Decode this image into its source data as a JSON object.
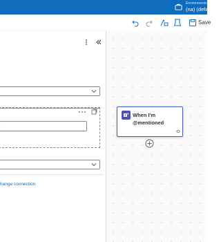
{
  "topbar": {
    "environment_label": "Environments",
    "environment_name": "(na) (defa"
  },
  "toolbar": {
    "save_label": "Save"
  },
  "panel": {
    "change_connection_link": "hange connection"
  },
  "canvas": {
    "trigger_card": {
      "title": "When I'm @mentioned"
    }
  },
  "colors": {
    "topbar_bg": "#0f6cbd",
    "card_border": "#3a5fcd",
    "teams_icon": "#4f52b2",
    "link": "#0f6cbd"
  },
  "icons": [
    "environment-icon",
    "undo-icon",
    "redo-icon",
    "flow-checker-icon",
    "test-icon",
    "save-icon",
    "more-options-icon",
    "collapse-panel-icon",
    "chevron-down-icon",
    "ellipsis-icon",
    "section-options-icon",
    "teams-icon",
    "connection-icon",
    "add-step-icon"
  ]
}
